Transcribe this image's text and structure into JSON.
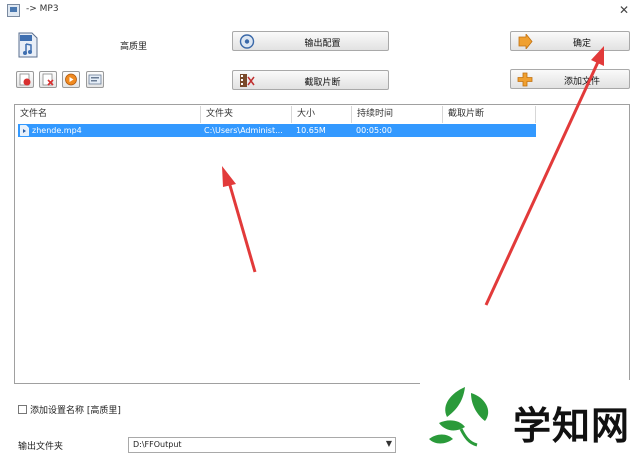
{
  "window": {
    "title": "-> MP3",
    "close_glyph": "✕"
  },
  "toolbar": {
    "profile_name": "高质里",
    "output_config_label": "输出配置",
    "clip_label": "截取片断",
    "ok_label": "确定",
    "add_file_label": "添加文件",
    "small_buttons": [
      "remove-icon",
      "clear-icon",
      "play-icon",
      "info-icon"
    ]
  },
  "file_list": {
    "columns": [
      "文件名",
      "文件夹",
      "大小",
      "持续时间",
      "截取片断"
    ],
    "rows": [
      {
        "name": "zhende.mp4",
        "folder": "C:\\Users\\Administ...",
        "size": "10.65M",
        "duration": "00:05:00",
        "clip": ""
      }
    ]
  },
  "options": {
    "add_profile_label": "添加设置名称 [高质里]",
    "output_folder_label": "输出文件夹",
    "output_folder_value": "D:\\FFOutput"
  },
  "watermark": {
    "text": "学知网"
  },
  "colors": {
    "selection": "#3399ff",
    "arrow": "#e23a3a",
    "watermark_green": "#2a9a3a"
  }
}
